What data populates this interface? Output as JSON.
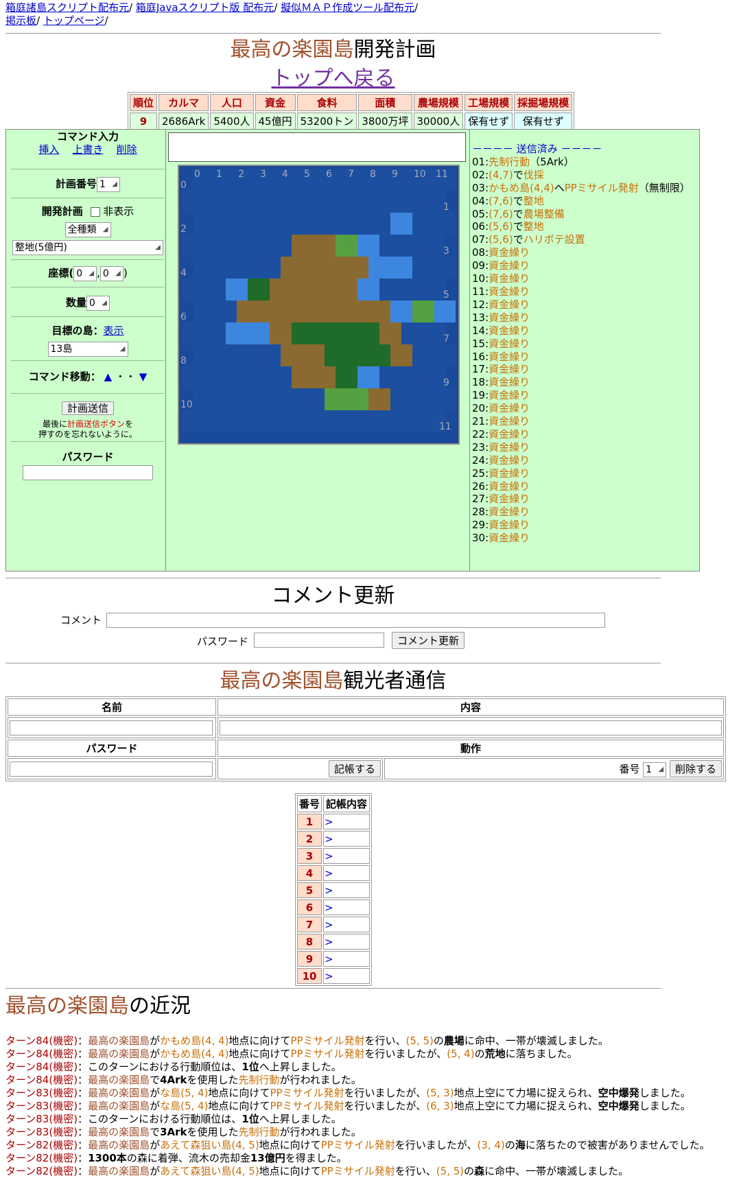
{
  "top_links": [
    "箱庭諸島スクリプト配布元",
    "箱庭Javaスクリプト版 配布元",
    "擬似ＭＡＰ作成ツール配布元",
    "掲示板",
    "トップページ"
  ],
  "header": {
    "island_name": "最高の楽園島",
    "title_suffix": "開発計画",
    "back_link": "トップへ戻る"
  },
  "stats": {
    "headers": [
      "順位",
      "カルマ",
      "人口",
      "資金",
      "食料",
      "面積",
      "農場規模",
      "工場規模",
      "採掘場規模"
    ],
    "values": [
      "9",
      "2686Ark",
      "5400人",
      "45億円",
      "53200トン",
      "3800万坪",
      "30000人",
      "保有せず",
      "保有せず"
    ]
  },
  "command": {
    "heading": "コマンド入力",
    "insert": "挿入",
    "overwrite": "上書き",
    "delete": "削除",
    "plan_number_label": "計画番号",
    "plan_number_value": "1",
    "dev_plan_label": "開発計画",
    "hide_label": "非表示",
    "category_value": "全種類",
    "action_value": "整地(5億円)",
    "coords_label": "座標(",
    "coord_x": "0",
    "coord_y": "0",
    "comma": ",",
    "close_paren": ")",
    "quantity_label": "数量",
    "quantity_value": "0",
    "target_label": "目標の島：",
    "target_show": "表示",
    "target_value": "13島",
    "move_label": "コマンド移動：",
    "move_dots": "・・",
    "send_button": "計画送信",
    "note_1": "最後に",
    "note_highlight": "計画送信ボタン",
    "note_2": "を",
    "note_3": "押すのを忘れないように。",
    "password_label": "パスワード"
  },
  "map": {
    "col_labels": [
      "0",
      "1",
      "2",
      "3",
      "4",
      "5",
      "6",
      "7",
      "8",
      "9",
      "10",
      "11"
    ],
    "row_labels": [
      "0",
      "1",
      "2",
      "3",
      "4",
      "5",
      "6",
      "7",
      "8",
      "9",
      "10",
      "11"
    ]
  },
  "log": {
    "heading": "－－－－ 送信済み －－－－",
    "entries": [
      {
        "num": "01:",
        "coord": "",
        "mid": "",
        "action": "先制行動",
        "suffix": "（5Ark）"
      },
      {
        "num": "02:",
        "coord": "(4,7)",
        "mid": "で",
        "action": "伐採",
        "suffix": ""
      },
      {
        "num": "03:",
        "coord": "かもめ島(4,4)",
        "mid": "へ",
        "action": "PPミサイル発射",
        "suffix": "（無制限）"
      },
      {
        "num": "04:",
        "coord": "(7,6)",
        "mid": "で",
        "action": "整地",
        "suffix": ""
      },
      {
        "num": "05:",
        "coord": "(7,6)",
        "mid": "で",
        "action": "農場整備",
        "suffix": ""
      },
      {
        "num": "06:",
        "coord": "(5,6)",
        "mid": "で",
        "action": "整地",
        "suffix": ""
      },
      {
        "num": "07:",
        "coord": "(5,6)",
        "mid": "で",
        "action": "ハリボテ設置",
        "suffix": ""
      },
      {
        "num": "08:",
        "coord": "",
        "mid": "",
        "action": "資金繰り",
        "suffix": ""
      },
      {
        "num": "09:",
        "coord": "",
        "mid": "",
        "action": "資金繰り",
        "suffix": ""
      },
      {
        "num": "10:",
        "coord": "",
        "mid": "",
        "action": "資金繰り",
        "suffix": ""
      },
      {
        "num": "11:",
        "coord": "",
        "mid": "",
        "action": "資金繰り",
        "suffix": ""
      },
      {
        "num": "12:",
        "coord": "",
        "mid": "",
        "action": "資金繰り",
        "suffix": ""
      },
      {
        "num": "13:",
        "coord": "",
        "mid": "",
        "action": "資金繰り",
        "suffix": ""
      },
      {
        "num": "14:",
        "coord": "",
        "mid": "",
        "action": "資金繰り",
        "suffix": ""
      },
      {
        "num": "15:",
        "coord": "",
        "mid": "",
        "action": "資金繰り",
        "suffix": ""
      },
      {
        "num": "16:",
        "coord": "",
        "mid": "",
        "action": "資金繰り",
        "suffix": ""
      },
      {
        "num": "17:",
        "coord": "",
        "mid": "",
        "action": "資金繰り",
        "suffix": ""
      },
      {
        "num": "18:",
        "coord": "",
        "mid": "",
        "action": "資金繰り",
        "suffix": ""
      },
      {
        "num": "19:",
        "coord": "",
        "mid": "",
        "action": "資金繰り",
        "suffix": ""
      },
      {
        "num": "20:",
        "coord": "",
        "mid": "",
        "action": "資金繰り",
        "suffix": ""
      },
      {
        "num": "21:",
        "coord": "",
        "mid": "",
        "action": "資金繰り",
        "suffix": ""
      },
      {
        "num": "22:",
        "coord": "",
        "mid": "",
        "action": "資金繰り",
        "suffix": ""
      },
      {
        "num": "23:",
        "coord": "",
        "mid": "",
        "action": "資金繰り",
        "suffix": ""
      },
      {
        "num": "24:",
        "coord": "",
        "mid": "",
        "action": "資金繰り",
        "suffix": ""
      },
      {
        "num": "25:",
        "coord": "",
        "mid": "",
        "action": "資金繰り",
        "suffix": ""
      },
      {
        "num": "26:",
        "coord": "",
        "mid": "",
        "action": "資金繰り",
        "suffix": ""
      },
      {
        "num": "27:",
        "coord": "",
        "mid": "",
        "action": "資金繰り",
        "suffix": ""
      },
      {
        "num": "28:",
        "coord": "",
        "mid": "",
        "action": "資金繰り",
        "suffix": ""
      },
      {
        "num": "29:",
        "coord": "",
        "mid": "",
        "action": "資金繰り",
        "suffix": ""
      },
      {
        "num": "30:",
        "coord": "",
        "mid": "",
        "action": "資金繰り",
        "suffix": ""
      }
    ]
  },
  "comment": {
    "heading": "コメント更新",
    "comment_label": "コメント",
    "password_label": "パスワード",
    "button": "コメント更新"
  },
  "guestbook": {
    "island_name": "最高の楽園島",
    "title_suffix": "観光者通信",
    "col_name": "名前",
    "col_content": "内容",
    "col_password": "パスワード",
    "col_action": "動作",
    "post_button": "記帳する",
    "number_label": "番号",
    "number_value": "1",
    "delete_button": "削除する"
  },
  "notes": {
    "col_num": "番号",
    "col_content": "記帳内容",
    "rows": [
      "1",
      "2",
      "3",
      "4",
      "5",
      "6",
      "7",
      "8",
      "9",
      "10"
    ],
    "marker": ">"
  },
  "recent": {
    "island_name": "最高の楽園島",
    "title_suffix": "の近況"
  },
  "colors": {
    "panel_bg": "#ccffcc",
    "island_name": "#a0522d",
    "command_text": "#c8700a",
    "rank_red": "#aa0000",
    "header_cell": "#ffddcc"
  }
}
